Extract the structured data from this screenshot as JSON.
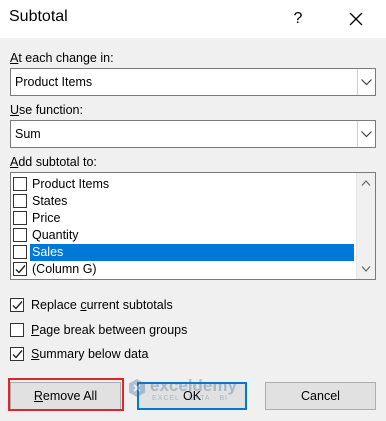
{
  "window": {
    "title": "Subtotal",
    "help_glyph": "?",
    "close_icon": "close-icon"
  },
  "at_each_change": {
    "label_key": "A",
    "label_rest": "t each change in:",
    "value": "Product Items"
  },
  "use_function": {
    "label_key": "U",
    "label_rest": "se function:",
    "value": "Sum"
  },
  "add_subtotal": {
    "label_key": "A",
    "label_rest": "dd subtotal to:",
    "items": [
      {
        "label": "Product Items",
        "checked": false,
        "selected": false
      },
      {
        "label": "States",
        "checked": false,
        "selected": false
      },
      {
        "label": "Price",
        "checked": false,
        "selected": false
      },
      {
        "label": "Quantity",
        "checked": false,
        "selected": false
      },
      {
        "label": "Sales",
        "checked": false,
        "selected": true
      },
      {
        "label": "(Column G)",
        "checked": true,
        "selected": false
      }
    ]
  },
  "options": {
    "replace": {
      "pre": "Replace ",
      "key": "c",
      "post": "urrent subtotals",
      "checked": true
    },
    "page_break": {
      "pre": "",
      "key": "P",
      "post": "age break between groups",
      "checked": false
    },
    "summary": {
      "pre": "",
      "key": "S",
      "post": "ummary below data",
      "checked": true
    }
  },
  "buttons": {
    "remove_all": {
      "key": "R",
      "rest": "emove All"
    },
    "ok": "OK",
    "cancel": "Cancel"
  },
  "watermark": {
    "name": "exceldemy",
    "sub": "EXCEL · DATA · BI"
  },
  "colors": {
    "selection": "#0078d7",
    "highlight_outline": "#e0242b"
  }
}
